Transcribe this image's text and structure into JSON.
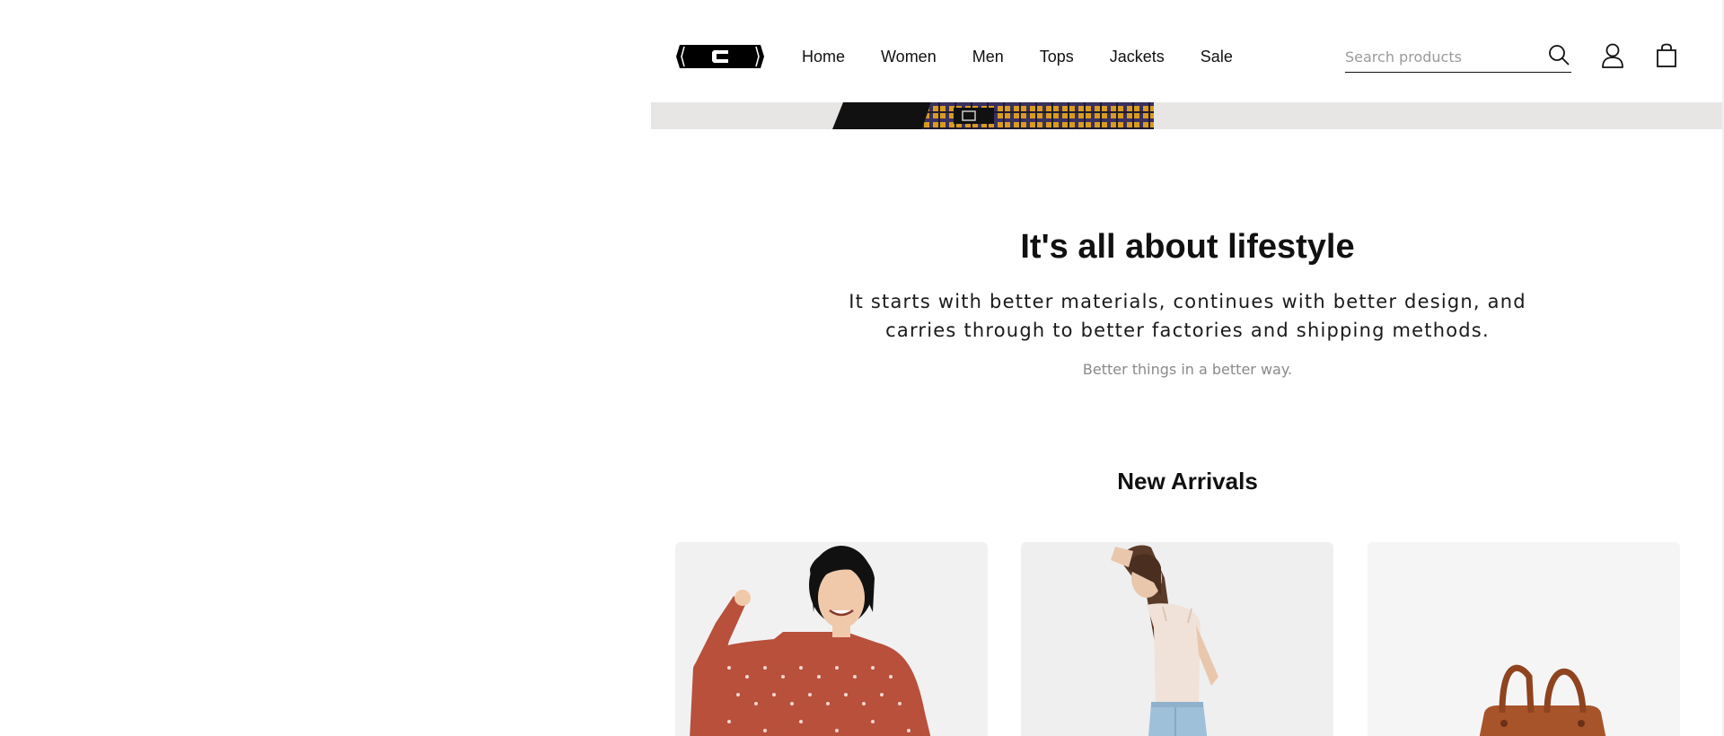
{
  "header": {
    "logo_icon": "brand-logo-icon",
    "nav": [
      "Home",
      "Women",
      "Men",
      "Tops",
      "Jackets",
      "Sale"
    ],
    "search": {
      "placeholder": "Search products",
      "icon": "search-icon"
    },
    "account_icon": "user-icon",
    "cart_icon": "shopping-bag-icon"
  },
  "lifestyle": {
    "title": "It's all about lifestyle",
    "text": "It starts with better materials, continues with better design, and carries through to better factories and shipping methods.",
    "subtitle": "Better things in a better way."
  },
  "new_arrivals": {
    "title": "New Arrivals",
    "products": [
      {
        "image": "woman-in-red-polka-dot-sweater"
      },
      {
        "image": "woman-in-tank-top-and-jeans"
      },
      {
        "image": "brown-leather-tote-bag"
      }
    ]
  },
  "colors": {
    "text": "#111111",
    "muted": "#8a8a8a",
    "hero_bg": "#e7e6e4",
    "plaid_gold": "#d79b1f"
  }
}
